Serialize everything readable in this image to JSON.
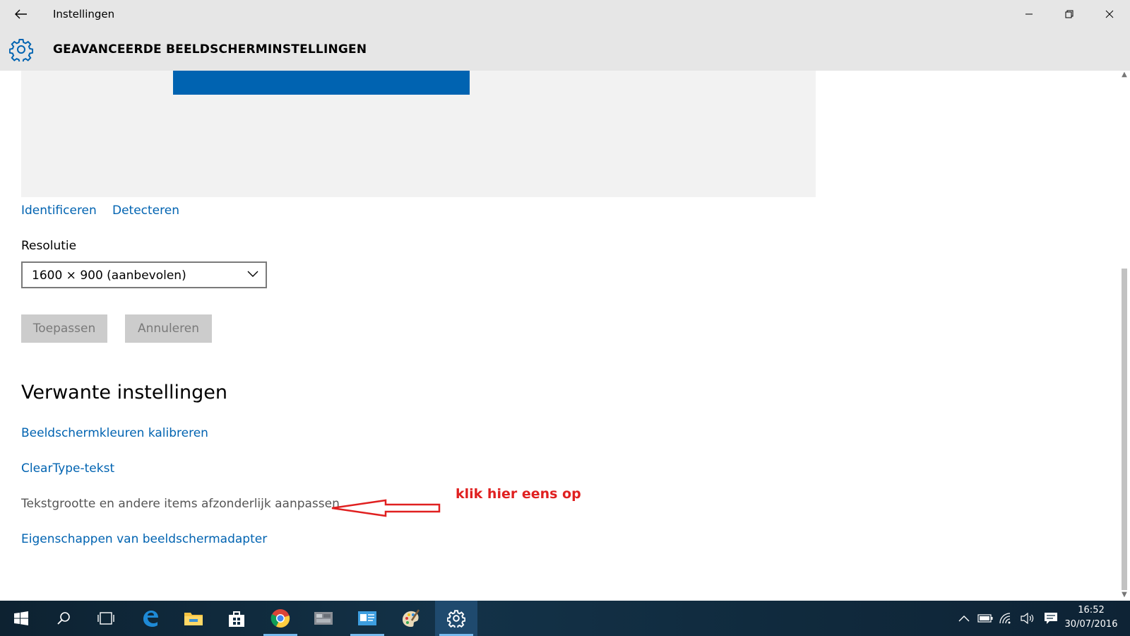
{
  "window": {
    "title": "Instellingen",
    "page_title": "GEAVANCEERDE BEELDSCHERMINSTELLINGEN",
    "back_icon": "back-arrow-icon",
    "settings_icon": "gear-icon"
  },
  "display": {
    "identify_label": "Identificeren",
    "detect_label": "Detecteren"
  },
  "resolution": {
    "label": "Resolutie",
    "selected": "1600 × 900 (aanbevolen)"
  },
  "buttons": {
    "apply_label": "Toepassen",
    "cancel_label": "Annuleren"
  },
  "related": {
    "heading": "Verwante instellingen",
    "items": [
      "Beeldschermkleuren kalibreren",
      "ClearType-tekst",
      "Tekstgrootte en andere items afzonderlijk aanpassen",
      "Eigenschappen van beeldschermadapter"
    ]
  },
  "annotation": {
    "text": "klik  hier eens op",
    "color": "#e02020"
  },
  "colors": {
    "accent": "#0063b1",
    "titlebar": "#e6e6e6",
    "preview_bg": "#f2f2f2"
  },
  "taskbar": {
    "apps": [
      "windows-start-icon",
      "search-icon",
      "task-view-icon",
      "edge-icon",
      "file-explorer-icon",
      "store-icon",
      "chrome-icon",
      "app-icon",
      "outlook-icon",
      "paint-icon",
      "settings-gear-icon"
    ],
    "tray": [
      "chevron-up-icon",
      "battery-icon",
      "wifi-icon",
      "volume-icon",
      "notification-icon"
    ],
    "time": "16:52",
    "date": "30/07/2016"
  }
}
